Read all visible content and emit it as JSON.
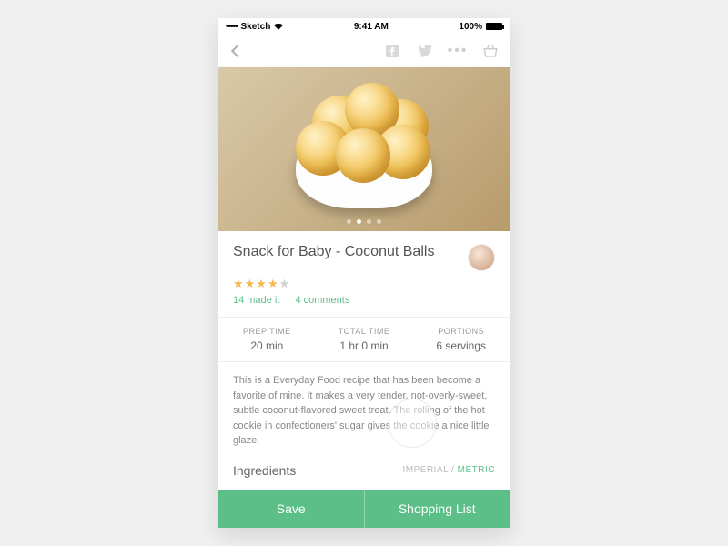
{
  "status": {
    "carrier": "Sketch",
    "time": "9:41 AM",
    "battery": "100%"
  },
  "recipe": {
    "title": "Snack for Baby - Coconut Balls",
    "rating": {
      "filled": 4,
      "total": 5
    },
    "made_it": "14 made it",
    "comments": "4 comments",
    "prep_label": "PREP TIME",
    "prep_value": "20 min",
    "total_label": "TOTAL TIME",
    "total_value": "1 hr  0 min",
    "portions_label": "PORTIONS",
    "portions_value": "6 servings",
    "description": "This is a Everyday Food recipe that has been become a favorite of mine. It makes a very tender, not-overly-sweet, subtle coconut-flavored sweet treat. The rolling of the hot cookie in confectioners' sugar gives the cookie a nice little glaze."
  },
  "ingredients": {
    "heading": "Ingredients",
    "imperial": "IMPERIAL",
    "sep": " / ",
    "metric": "METRIC"
  },
  "buttons": {
    "save": "Save",
    "shopping": "Shopping List"
  },
  "status_dots": "•••••"
}
